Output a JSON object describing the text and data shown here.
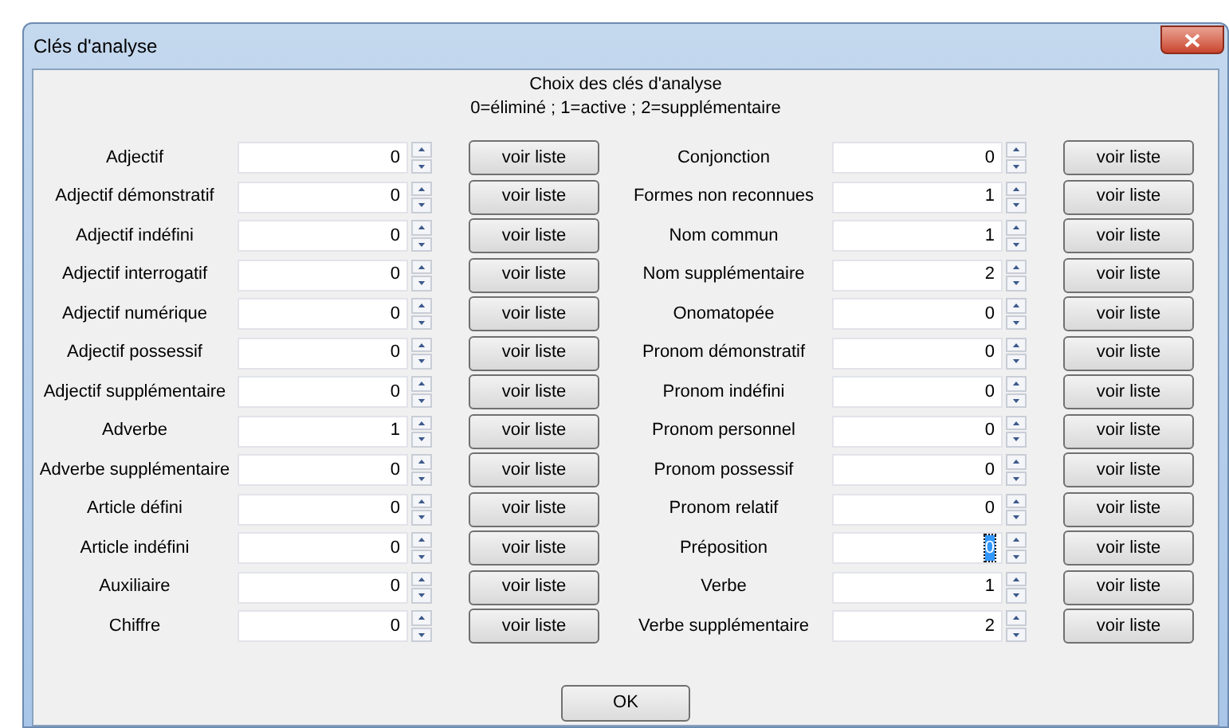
{
  "window": {
    "title": "Clés d'analyse"
  },
  "header": {
    "title": "Choix des clés d'analyse",
    "legend": "0=éliminé ; 1=active ; 2=supplémentaire"
  },
  "columns": [
    {
      "rows": [
        {
          "label": "Adjectif",
          "value": "0",
          "selected": false,
          "button": "voir liste"
        },
        {
          "label": "Adjectif démonstratif",
          "value": "0",
          "selected": false,
          "button": "voir liste"
        },
        {
          "label": "Adjectif indéfini",
          "value": "0",
          "selected": false,
          "button": "voir liste"
        },
        {
          "label": "Adjectif interrogatif",
          "value": "0",
          "selected": false,
          "button": "voir liste"
        },
        {
          "label": "Adjectif numérique",
          "value": "0",
          "selected": false,
          "button": "voir liste"
        },
        {
          "label": "Adjectif possessif",
          "value": "0",
          "selected": false,
          "button": "voir liste"
        },
        {
          "label": "Adjectif supplémentaire",
          "value": "0",
          "selected": false,
          "button": "voir liste"
        },
        {
          "label": "Adverbe",
          "value": "1",
          "selected": false,
          "button": "voir liste"
        },
        {
          "label": "Adverbe supplémentaire",
          "value": "0",
          "selected": false,
          "button": "voir liste"
        },
        {
          "label": "Article défini",
          "value": "0",
          "selected": false,
          "button": "voir liste"
        },
        {
          "label": "Article indéfini",
          "value": "0",
          "selected": false,
          "button": "voir liste"
        },
        {
          "label": "Auxiliaire",
          "value": "0",
          "selected": false,
          "button": "voir liste"
        },
        {
          "label": "Chiffre",
          "value": "0",
          "selected": false,
          "button": "voir liste"
        }
      ]
    },
    {
      "rows": [
        {
          "label": "Conjonction",
          "value": "0",
          "selected": false,
          "button": "voir liste"
        },
        {
          "label": "Formes non reconnues",
          "value": "1",
          "selected": false,
          "button": "voir liste"
        },
        {
          "label": "Nom commun",
          "value": "1",
          "selected": false,
          "button": "voir liste"
        },
        {
          "label": "Nom supplémentaire",
          "value": "2",
          "selected": false,
          "button": "voir liste"
        },
        {
          "label": "Onomatopée",
          "value": "0",
          "selected": false,
          "button": "voir liste"
        },
        {
          "label": "Pronom démonstratif",
          "value": "0",
          "selected": false,
          "button": "voir liste"
        },
        {
          "label": "Pronom indéfini",
          "value": "0",
          "selected": false,
          "button": "voir liste"
        },
        {
          "label": "Pronom personnel",
          "value": "0",
          "selected": false,
          "button": "voir liste"
        },
        {
          "label": "Pronom possessif",
          "value": "0",
          "selected": false,
          "button": "voir liste"
        },
        {
          "label": "Pronom relatif",
          "value": "0",
          "selected": false,
          "button": "voir liste"
        },
        {
          "label": "Préposition",
          "value": "0",
          "selected": true,
          "button": "voir liste"
        },
        {
          "label": "Verbe",
          "value": "1",
          "selected": false,
          "button": "voir liste"
        },
        {
          "label": "Verbe supplémentaire",
          "value": "2",
          "selected": false,
          "button": "voir liste"
        }
      ]
    }
  ],
  "ok_button": "OK"
}
